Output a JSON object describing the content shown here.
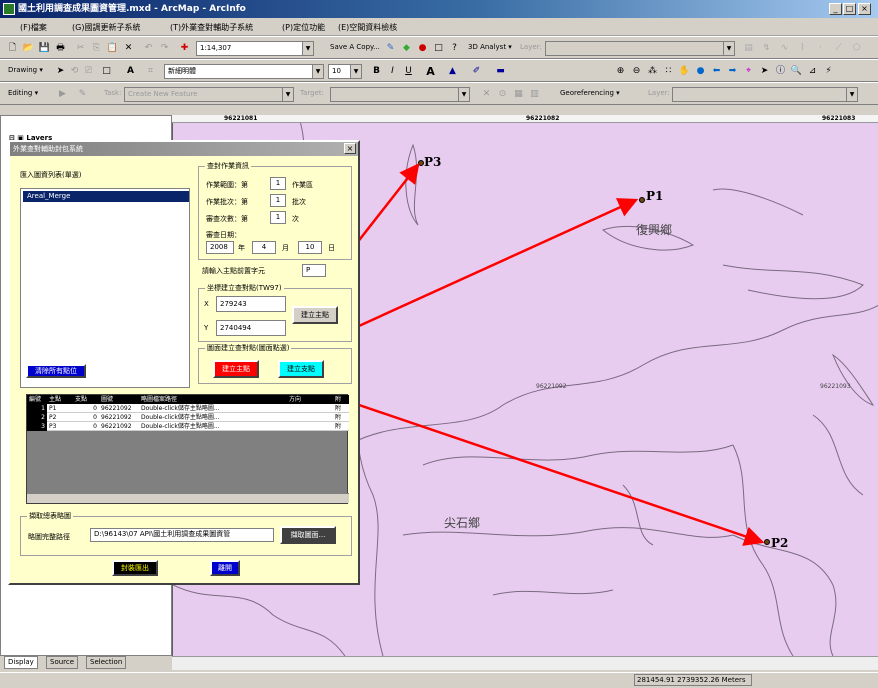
{
  "window": {
    "title": "國土利用調查成果圖資管理.mxd - ArcMap - ArcInfo",
    "min": "_",
    "max": "□",
    "close": "×"
  },
  "menu": [
    "(F)檔案",
    "(G)國調更新子系統",
    "(T)外業查對輔助子系統",
    "(P)定位功能",
    "(E)空間資料檢核"
  ],
  "toolbar1": {
    "scale": "1:14,307",
    "save_a_copy": "Save A Copy...",
    "analyst": "3D Analyst ▾",
    "layer_label": "Layer:"
  },
  "toolbar2": {
    "drawing": "Drawing ▾",
    "font": "新細明體",
    "size": "10",
    "bold": "B",
    "italic": "I",
    "underline": "U",
    "font_color": "A"
  },
  "toolbar3": {
    "editing": "Editing ▾",
    "task_label": "Task:",
    "task": "Create New Feature",
    "target_label": "Target:",
    "georef": "Georeferencing ▾",
    "layer_label": "Layer:"
  },
  "ruler": [
    "96221081",
    "96221082",
    "96221083"
  ],
  "map": {
    "labels": [
      "復興鄉",
      "尖石鄉"
    ],
    "small_labels": [
      "96221092",
      "96221093"
    ],
    "points": [
      "P1",
      "P2",
      "P3"
    ],
    "arrow_color": "#ff0000",
    "fill_color": "#e8ccf0"
  },
  "toc": {
    "root": "Layers",
    "tabs": [
      "Display",
      "Source",
      "Selection"
    ]
  },
  "status": {
    "coords": "281454.91  2739352.26 Meters"
  },
  "dialog": {
    "title": "外業查對輔助封包系統",
    "close": "×",
    "layer_list_label": "匯入圖資列表(單選)",
    "layer_list_items": [
      "Areal_Merge"
    ],
    "info_group": "查封作業資訊",
    "area_label": "作業範圍：第",
    "area_val": "1",
    "area_unit": "作業區",
    "batch_label": "作業批次：第",
    "batch_val": "1",
    "batch_unit": "批次",
    "times_label": "審查次數：第",
    "times_val": "1",
    "times_unit": "次",
    "date_label": "審查日期：",
    "year": "2008",
    "year_unit": "年",
    "month": "4",
    "month_unit": "月",
    "day": "10",
    "day_unit": "日",
    "prefix_label": "請輸入主點前置字元",
    "prefix_val": "P",
    "coord_group": "坐標建立查對點(TW97)",
    "x_label": "X",
    "x_val": "279243",
    "y_label": "Y",
    "y_val": "2740494",
    "build_main_btn": "建立主點",
    "map_group": "圖面建立查對點(圖面點選)",
    "map_main_btn": "建立主點",
    "map_sub_btn": "建立支點",
    "clear_btn": "清除所有點位",
    "grid_headers": [
      "編號",
      "主點",
      "支點",
      "圖號",
      "略圖檔案路徑",
      "方向",
      "附"
    ],
    "grid_rows": [
      [
        "1",
        "P1",
        "0",
        "96221092",
        "Double-click儲存主點略圖...",
        "",
        "附"
      ],
      [
        "2",
        "P2",
        "0",
        "96221092",
        "Double-click儲存主點略圖...",
        "",
        "附"
      ],
      [
        "3",
        "P3",
        "0",
        "96221092",
        "Double-click儲存主點略圖...",
        "",
        "附"
      ]
    ],
    "overview_group": "擷取總表略圖",
    "overview_label": "略圖完整路徑",
    "overview_val": "D:\\96143\\07 API\\國土利用調查成果圖資管",
    "overview_btn": "擷取圖面...",
    "export_btn": "封裝匯出",
    "exit_btn": "離開"
  }
}
